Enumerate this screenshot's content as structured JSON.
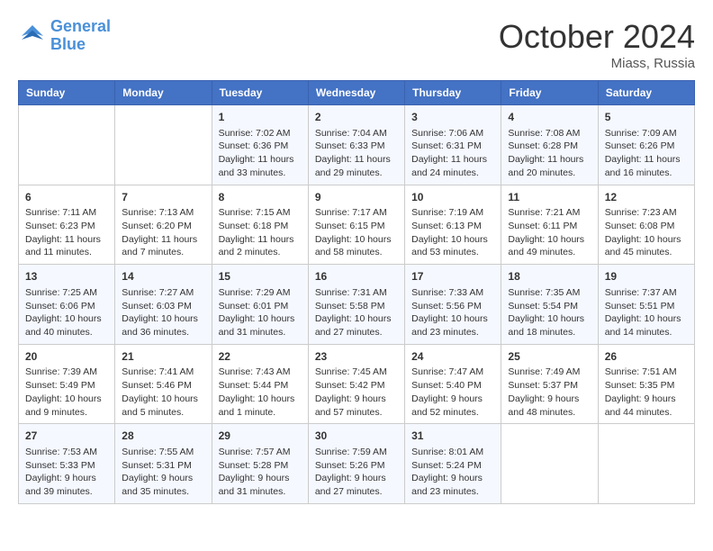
{
  "logo": {
    "line1": "General",
    "line2": "Blue"
  },
  "title": "October 2024",
  "location": "Miass, Russia",
  "days_header": [
    "Sunday",
    "Monday",
    "Tuesday",
    "Wednesday",
    "Thursday",
    "Friday",
    "Saturday"
  ],
  "weeks": [
    [
      {
        "day": "",
        "sunrise": "",
        "sunset": "",
        "daylight": ""
      },
      {
        "day": "",
        "sunrise": "",
        "sunset": "",
        "daylight": ""
      },
      {
        "day": "1",
        "sunrise": "Sunrise: 7:02 AM",
        "sunset": "Sunset: 6:36 PM",
        "daylight": "Daylight: 11 hours and 33 minutes."
      },
      {
        "day": "2",
        "sunrise": "Sunrise: 7:04 AM",
        "sunset": "Sunset: 6:33 PM",
        "daylight": "Daylight: 11 hours and 29 minutes."
      },
      {
        "day": "3",
        "sunrise": "Sunrise: 7:06 AM",
        "sunset": "Sunset: 6:31 PM",
        "daylight": "Daylight: 11 hours and 24 minutes."
      },
      {
        "day": "4",
        "sunrise": "Sunrise: 7:08 AM",
        "sunset": "Sunset: 6:28 PM",
        "daylight": "Daylight: 11 hours and 20 minutes."
      },
      {
        "day": "5",
        "sunrise": "Sunrise: 7:09 AM",
        "sunset": "Sunset: 6:26 PM",
        "daylight": "Daylight: 11 hours and 16 minutes."
      }
    ],
    [
      {
        "day": "6",
        "sunrise": "Sunrise: 7:11 AM",
        "sunset": "Sunset: 6:23 PM",
        "daylight": "Daylight: 11 hours and 11 minutes."
      },
      {
        "day": "7",
        "sunrise": "Sunrise: 7:13 AM",
        "sunset": "Sunset: 6:20 PM",
        "daylight": "Daylight: 11 hours and 7 minutes."
      },
      {
        "day": "8",
        "sunrise": "Sunrise: 7:15 AM",
        "sunset": "Sunset: 6:18 PM",
        "daylight": "Daylight: 11 hours and 2 minutes."
      },
      {
        "day": "9",
        "sunrise": "Sunrise: 7:17 AM",
        "sunset": "Sunset: 6:15 PM",
        "daylight": "Daylight: 10 hours and 58 minutes."
      },
      {
        "day": "10",
        "sunrise": "Sunrise: 7:19 AM",
        "sunset": "Sunset: 6:13 PM",
        "daylight": "Daylight: 10 hours and 53 minutes."
      },
      {
        "day": "11",
        "sunrise": "Sunrise: 7:21 AM",
        "sunset": "Sunset: 6:11 PM",
        "daylight": "Daylight: 10 hours and 49 minutes."
      },
      {
        "day": "12",
        "sunrise": "Sunrise: 7:23 AM",
        "sunset": "Sunset: 6:08 PM",
        "daylight": "Daylight: 10 hours and 45 minutes."
      }
    ],
    [
      {
        "day": "13",
        "sunrise": "Sunrise: 7:25 AM",
        "sunset": "Sunset: 6:06 PM",
        "daylight": "Daylight: 10 hours and 40 minutes."
      },
      {
        "day": "14",
        "sunrise": "Sunrise: 7:27 AM",
        "sunset": "Sunset: 6:03 PM",
        "daylight": "Daylight: 10 hours and 36 minutes."
      },
      {
        "day": "15",
        "sunrise": "Sunrise: 7:29 AM",
        "sunset": "Sunset: 6:01 PM",
        "daylight": "Daylight: 10 hours and 31 minutes."
      },
      {
        "day": "16",
        "sunrise": "Sunrise: 7:31 AM",
        "sunset": "Sunset: 5:58 PM",
        "daylight": "Daylight: 10 hours and 27 minutes."
      },
      {
        "day": "17",
        "sunrise": "Sunrise: 7:33 AM",
        "sunset": "Sunset: 5:56 PM",
        "daylight": "Daylight: 10 hours and 23 minutes."
      },
      {
        "day": "18",
        "sunrise": "Sunrise: 7:35 AM",
        "sunset": "Sunset: 5:54 PM",
        "daylight": "Daylight: 10 hours and 18 minutes."
      },
      {
        "day": "19",
        "sunrise": "Sunrise: 7:37 AM",
        "sunset": "Sunset: 5:51 PM",
        "daylight": "Daylight: 10 hours and 14 minutes."
      }
    ],
    [
      {
        "day": "20",
        "sunrise": "Sunrise: 7:39 AM",
        "sunset": "Sunset: 5:49 PM",
        "daylight": "Daylight: 10 hours and 9 minutes."
      },
      {
        "day": "21",
        "sunrise": "Sunrise: 7:41 AM",
        "sunset": "Sunset: 5:46 PM",
        "daylight": "Daylight: 10 hours and 5 minutes."
      },
      {
        "day": "22",
        "sunrise": "Sunrise: 7:43 AM",
        "sunset": "Sunset: 5:44 PM",
        "daylight": "Daylight: 10 hours and 1 minute."
      },
      {
        "day": "23",
        "sunrise": "Sunrise: 7:45 AM",
        "sunset": "Sunset: 5:42 PM",
        "daylight": "Daylight: 9 hours and 57 minutes."
      },
      {
        "day": "24",
        "sunrise": "Sunrise: 7:47 AM",
        "sunset": "Sunset: 5:40 PM",
        "daylight": "Daylight: 9 hours and 52 minutes."
      },
      {
        "day": "25",
        "sunrise": "Sunrise: 7:49 AM",
        "sunset": "Sunset: 5:37 PM",
        "daylight": "Daylight: 9 hours and 48 minutes."
      },
      {
        "day": "26",
        "sunrise": "Sunrise: 7:51 AM",
        "sunset": "Sunset: 5:35 PM",
        "daylight": "Daylight: 9 hours and 44 minutes."
      }
    ],
    [
      {
        "day": "27",
        "sunrise": "Sunrise: 7:53 AM",
        "sunset": "Sunset: 5:33 PM",
        "daylight": "Daylight: 9 hours and 39 minutes."
      },
      {
        "day": "28",
        "sunrise": "Sunrise: 7:55 AM",
        "sunset": "Sunset: 5:31 PM",
        "daylight": "Daylight: 9 hours and 35 minutes."
      },
      {
        "day": "29",
        "sunrise": "Sunrise: 7:57 AM",
        "sunset": "Sunset: 5:28 PM",
        "daylight": "Daylight: 9 hours and 31 minutes."
      },
      {
        "day": "30",
        "sunrise": "Sunrise: 7:59 AM",
        "sunset": "Sunset: 5:26 PM",
        "daylight": "Daylight: 9 hours and 27 minutes."
      },
      {
        "day": "31",
        "sunrise": "Sunrise: 8:01 AM",
        "sunset": "Sunset: 5:24 PM",
        "daylight": "Daylight: 9 hours and 23 minutes."
      },
      {
        "day": "",
        "sunrise": "",
        "sunset": "",
        "daylight": ""
      },
      {
        "day": "",
        "sunrise": "",
        "sunset": "",
        "daylight": ""
      }
    ]
  ]
}
